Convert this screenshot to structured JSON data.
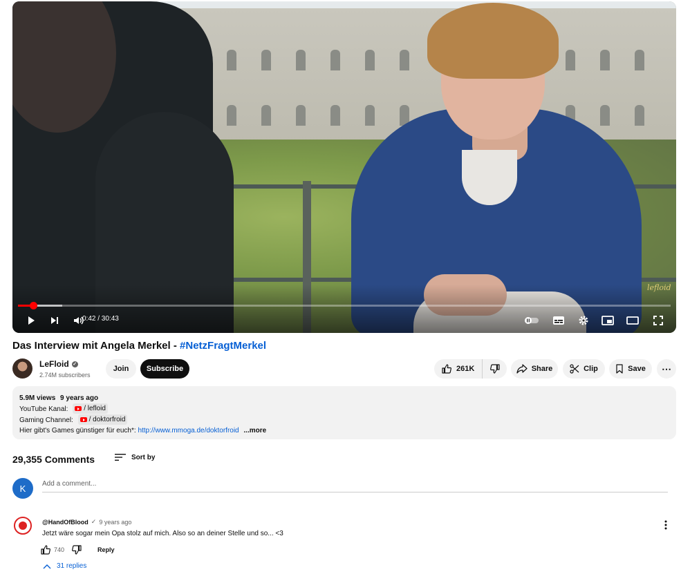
{
  "player": {
    "time_display": "0:42 / 30:43",
    "progress_fraction": 0.0228,
    "buffered_fraction": 0.068,
    "watermark": "lefloid"
  },
  "video": {
    "title": "Das Interview mit Angela Merkel -",
    "hashtag": "#NetzFragtMerkel"
  },
  "channel": {
    "name": "LeFloid",
    "subscribers": "2.74M subscribers"
  },
  "actions": {
    "join": "Join",
    "subscribe": "Subscribe",
    "likes": "261K",
    "share": "Share",
    "clip": "Clip",
    "save": "Save",
    "more": "⋯"
  },
  "description": {
    "views": "5.9M views",
    "age": "9 years ago",
    "line1_label": "YouTube Kanal:",
    "line1_chip": "/ lefloid",
    "line2_label": "Gaming Channel:",
    "line2_chip": "/ doktorfroid",
    "line3_text": "Hier gibt's Games günstiger für euch*:",
    "line3_link": "http://www.mmoga.de/doktorfroid",
    "more": "...more"
  },
  "comments": {
    "count": "29,355 Comments",
    "sort_label": "Sort by",
    "user_initial": "K",
    "placeholder": "Add a comment...",
    "items": [
      {
        "author": "@HandOfBlood",
        "verified_mark": "✓",
        "when": "9 years ago",
        "text": "Jetzt wäre sogar mein Opa stolz auf mich. Also so an deiner Stelle und so... <3",
        "likes": "740",
        "reply_label": "Reply",
        "replies_label": "31 replies"
      }
    ]
  },
  "colors": {
    "accent_red": "#ff0000",
    "link_blue": "#065fd4",
    "pill_bg": "#f2f2f2"
  }
}
